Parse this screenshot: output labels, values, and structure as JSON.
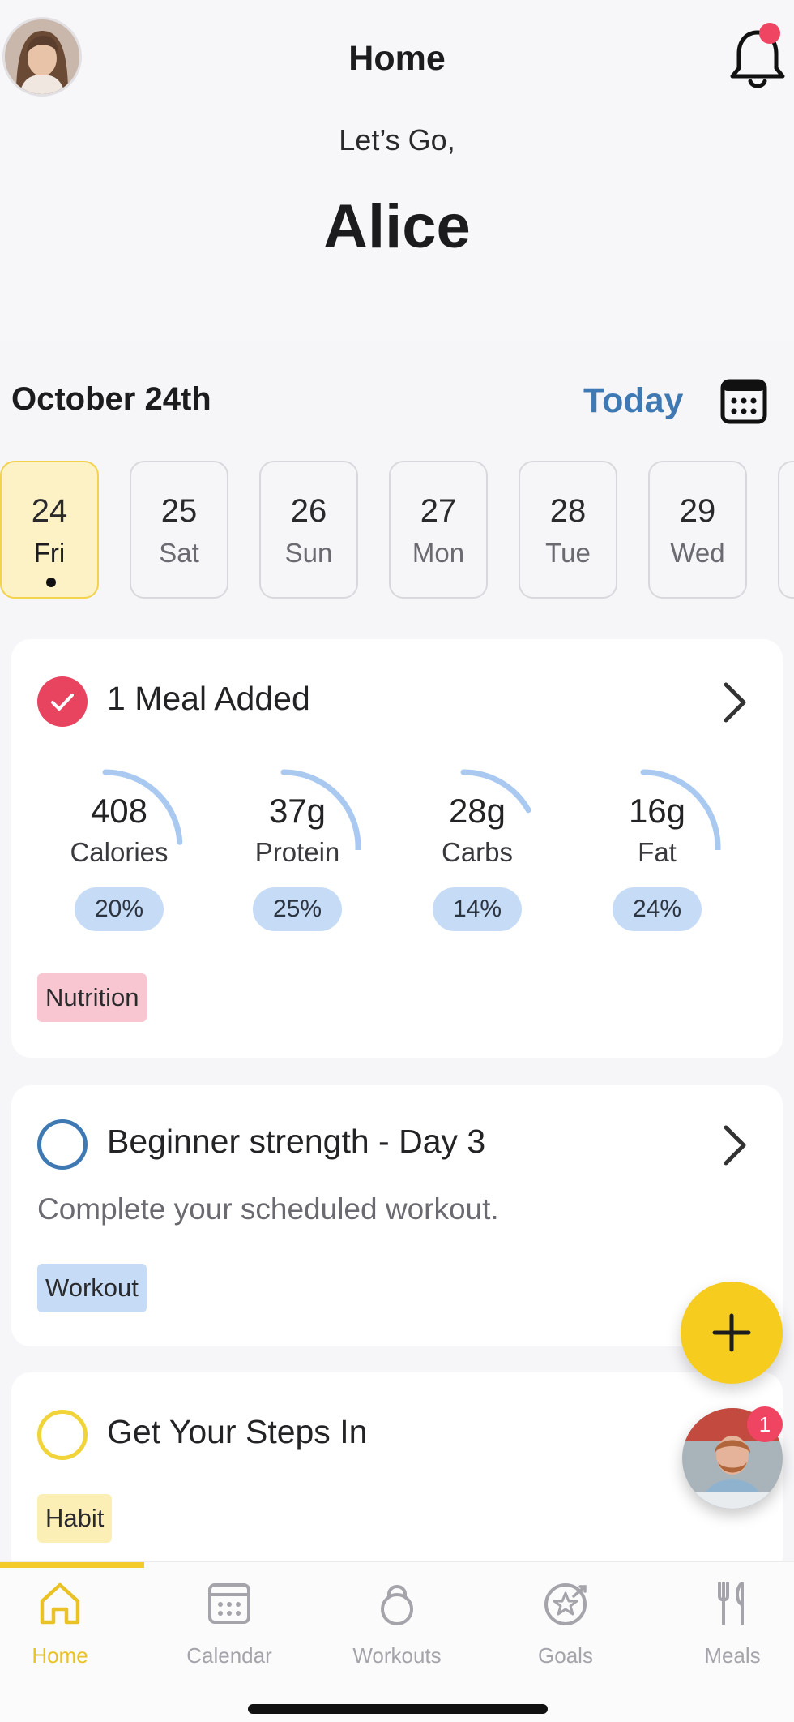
{
  "header": {
    "title": "Home",
    "greeting": "Let’s Go,",
    "name": "Alice",
    "avatar_icon": "user-avatar",
    "notifications_icon": "bell-icon"
  },
  "date_strip": {
    "date_label": "October 24th",
    "today_label": "Today",
    "calendar_icon": "calendar-icon",
    "days": [
      {
        "num": "24",
        "dow": "Fri",
        "selected": true,
        "has_dot": true
      },
      {
        "num": "25",
        "dow": "Sat"
      },
      {
        "num": "26",
        "dow": "Sun"
      },
      {
        "num": "27",
        "dow": "Mon"
      },
      {
        "num": "28",
        "dow": "Tue"
      },
      {
        "num": "29",
        "dow": "Wed"
      }
    ]
  },
  "meal_card": {
    "title": "1 Meal Added",
    "tag": "Nutrition",
    "macros": [
      {
        "value": "408",
        "label": "Calories",
        "percent": "20%",
        "fraction": 0.2
      },
      {
        "value": "37g",
        "label": "Protein",
        "percent": "25%",
        "fraction": 0.25
      },
      {
        "value": "28g",
        "label": "Carbs",
        "percent": "14%",
        "fraction": 0.14
      },
      {
        "value": "16g",
        "label": "Fat",
        "percent": "24%",
        "fraction": 0.24
      }
    ]
  },
  "workout_card": {
    "title": "Beginner strength - Day 3",
    "subtitle": "Complete your scheduled workout.",
    "tag": "Workout"
  },
  "habit_card": {
    "title": "Get Your Steps In",
    "tag": "Habit"
  },
  "fab": {
    "label": "+"
  },
  "coach": {
    "badge": "1"
  },
  "tabbar": {
    "items": [
      {
        "label": "Home",
        "icon": "home-icon",
        "active": true
      },
      {
        "label": "Calendar",
        "icon": "calendar-icon"
      },
      {
        "label": "Workouts",
        "icon": "kettlebell-icon"
      },
      {
        "label": "Goals",
        "icon": "goal-target-icon"
      },
      {
        "label": "Meals",
        "icon": "fork-knife-icon"
      }
    ]
  },
  "colors": {
    "accent_yellow": "#f6cc1f",
    "accent_blue": "#3f79b4",
    "meal_red": "#e9445f",
    "arc_blue": "#a9c9f1"
  }
}
